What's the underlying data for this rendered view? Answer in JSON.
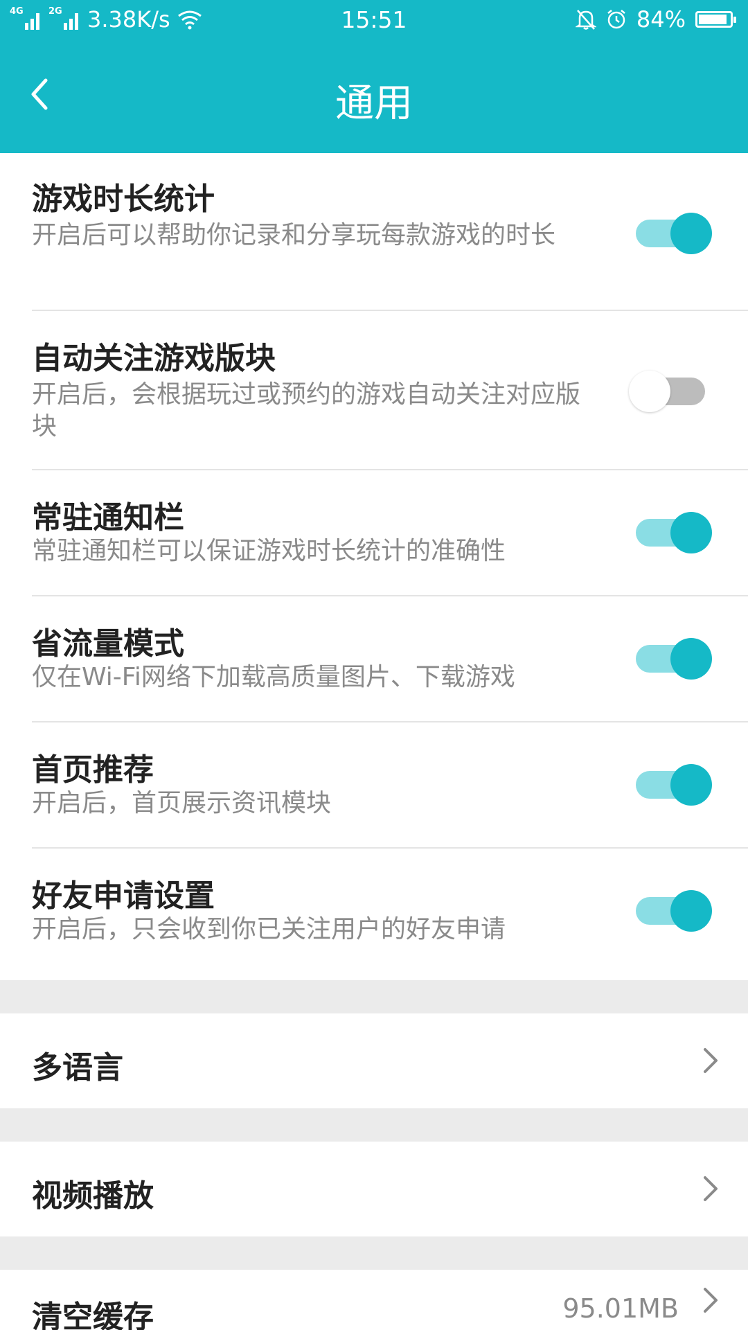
{
  "status_bar": {
    "net1": "4G",
    "net2": "2G",
    "speed": "3.38K/s",
    "time": "15:51",
    "battery": "84%",
    "battery_level": 0.84,
    "icons": [
      "signal-icon",
      "wifi-icon",
      "bell-muted-icon",
      "alarm-icon",
      "battery-icon"
    ]
  },
  "header": {
    "title": "通用",
    "back_icon": "chevron-left-icon"
  },
  "toggle_settings": [
    {
      "title": "游戏时长统计",
      "subtitle": "开启后可以帮助你记录和分享玩每款游戏的时长",
      "enabled": true
    },
    {
      "title": "自动关注游戏版块",
      "subtitle": "开启后，会根据玩过或预约的游戏自动关注对应版块",
      "enabled": false
    },
    {
      "title": "常驻通知栏",
      "subtitle": "常驻通知栏可以保证游戏时长统计的准确性",
      "enabled": true
    },
    {
      "title": "省流量模式",
      "subtitle": "仅在Wi-Fi网络下加载高质量图片、下载游戏",
      "enabled": true
    },
    {
      "title": "首页推荐",
      "subtitle": "开启后，首页展示资讯模块",
      "enabled": true
    },
    {
      "title": "好友申请设置",
      "subtitle": "开启后，只会收到你已关注用户的好友申请",
      "enabled": true
    }
  ],
  "nav_items": [
    {
      "title": "多语言"
    },
    {
      "title": "视频播放"
    },
    {
      "title": "清空缓存",
      "value": "95.01MB"
    }
  ],
  "colors": {
    "accent": "#15b9c7",
    "accent_light": "#8adde4",
    "toggle_off": "#bcbcbc",
    "background": "#ebebeb"
  }
}
